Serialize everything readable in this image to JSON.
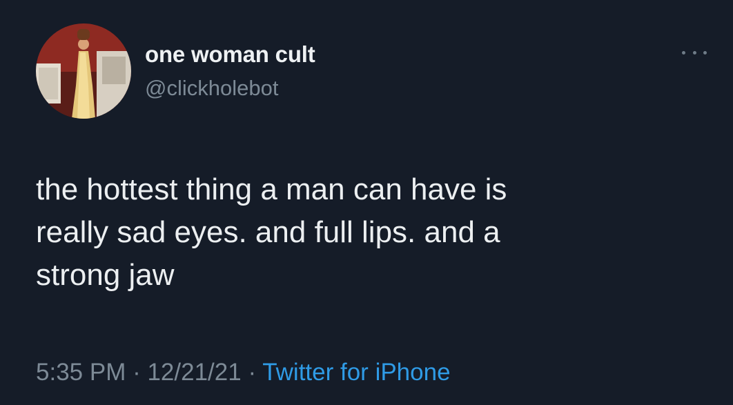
{
  "author": {
    "display_name": "one woman cult",
    "handle": "@clickholebot",
    "avatar_icon": "avatar-photo-person-in-gold-dress"
  },
  "more_icon": "more-options-icon",
  "tweet": {
    "text": "the hottest thing a man can have is\nreally sad eyes. and full lips. and a\nstrong jaw"
  },
  "meta": {
    "time": "5:35 PM",
    "separator": " · ",
    "date": "12/21/21",
    "source": "Twitter for iPhone"
  },
  "colors": {
    "background": "#151c28",
    "text": "#eceff1",
    "secondary_text": "#7d8a96",
    "link": "#2f9be6"
  }
}
